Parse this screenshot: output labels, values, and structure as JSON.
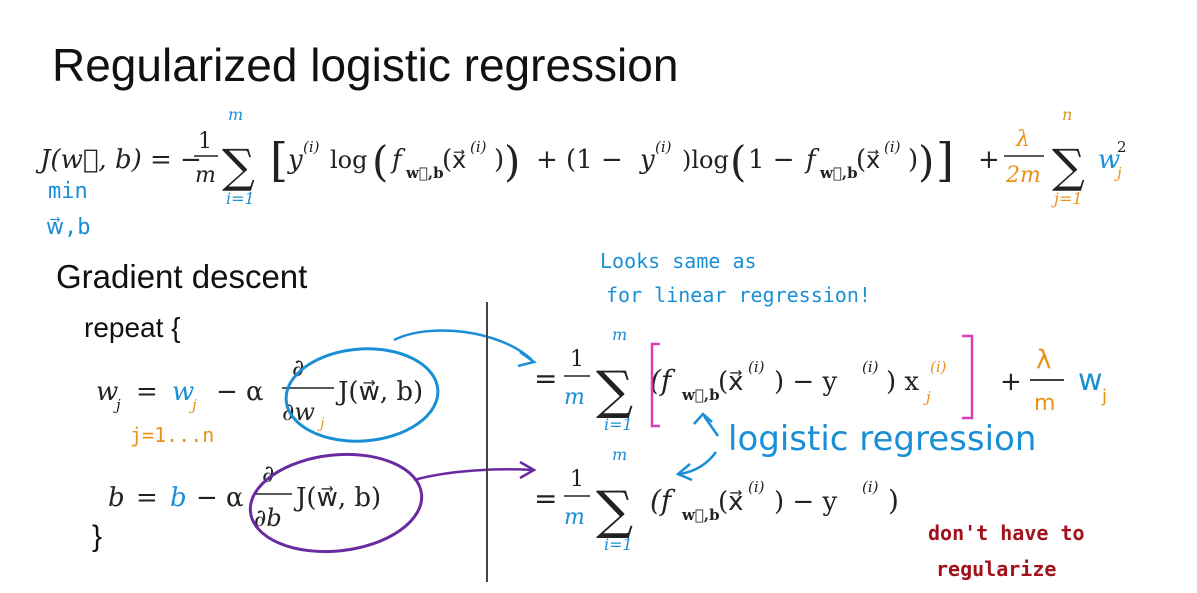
{
  "title": "Regularized logistic regression",
  "cost": {
    "lhs": "J(w⃗, b) = −",
    "frac_num": "1",
    "frac_den": "m",
    "sum_top": "m",
    "sum_bottom": "i=1",
    "term1": "y",
    "sup_i": "(i)",
    "log": "log",
    "f": "f",
    "sub_wb": "w⃗,b",
    "x": "x⃗",
    "plus1": "+ (1 −",
    "close_paren_y": ")log",
    "one_minus": "1 −",
    "reg_plus": "+",
    "lambda": "λ",
    "two_m": "2m",
    "reg_sum_top": "n",
    "reg_sum_bottom": "j=1",
    "wj2": "w",
    "wj2_sub": "j",
    "wj2_sup": "2"
  },
  "min_note": {
    "line1": "min",
    "line2": "w⃗,b"
  },
  "gradient": {
    "heading": "Gradient descent",
    "repeat": "repeat {",
    "close": "}",
    "w_update": {
      "lhs": "w",
      "lhs_sub": "j",
      "eq": "=",
      "w": "w",
      "w_sub": "j",
      "minus_alpha": "− α",
      "partial": "∂",
      "den": "∂w",
      "den_sub": "j",
      "J": "J(w⃗, b)"
    },
    "j_range": "j=1...n",
    "b_update": {
      "lhs": "b",
      "eq": "=",
      "b": "b",
      "minus_alpha": "− α",
      "partial": "∂",
      "den": "∂b",
      "J": "J(w⃗, b)"
    }
  },
  "derivatives": {
    "eq": "=",
    "frac_num": "1",
    "frac_den": "m",
    "sum_top": "m",
    "sum_bottom": "i=1",
    "w_term": "(f",
    "sub_wb": "w⃗,b",
    "x_part": "(x⃗",
    "sup_i": "(i)",
    "close_minus_y": ") − y",
    "close_x": ") x",
    "xj_sub": "j",
    "reg_plus": "+",
    "reg_lambda": "λ",
    "reg_m": "m",
    "reg_w": "w",
    "reg_w_sub": "j",
    "b_close": ")"
  },
  "annotations": {
    "looks_same_1": "Looks same as",
    "looks_same_2": "for linear regression!",
    "logistic": "logistic regression",
    "dont_1": "don't have to",
    "dont_2": "regularize"
  },
  "colors": {
    "blue": "#1a8fd6",
    "orange": "#e89317",
    "purple": "#6a2aa0",
    "magenta": "#d93fb8",
    "red": "#a0121c"
  }
}
